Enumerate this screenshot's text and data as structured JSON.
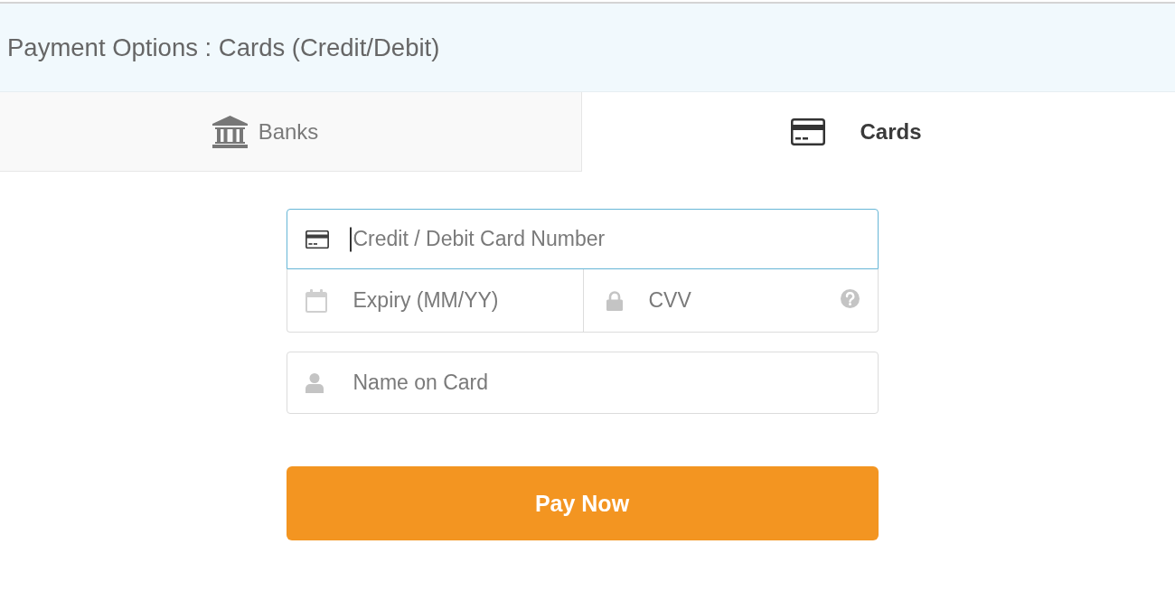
{
  "header": {
    "title": "Payment Options : Cards (Credit/Debit)"
  },
  "tabs": [
    {
      "label": "Banks",
      "selected": false
    },
    {
      "label": "Cards",
      "selected": true
    }
  ],
  "card_box": {
    "fields": [
      {
        "kind": "card_number",
        "placeholder": "Credit / Debit Card Number",
        "focused": true
      },
      {
        "kind": "expiry",
        "placeholder": "Expiry (MM/YY)",
        "focused": false
      },
      {
        "kind": "cvv",
        "placeholder": "CVV",
        "focused": false
      }
    ]
  },
  "name_field": {
    "kind": "name",
    "placeholder": "Name on Card",
    "focused": false
  },
  "pay_button": {
    "label": "Pay Now"
  }
}
